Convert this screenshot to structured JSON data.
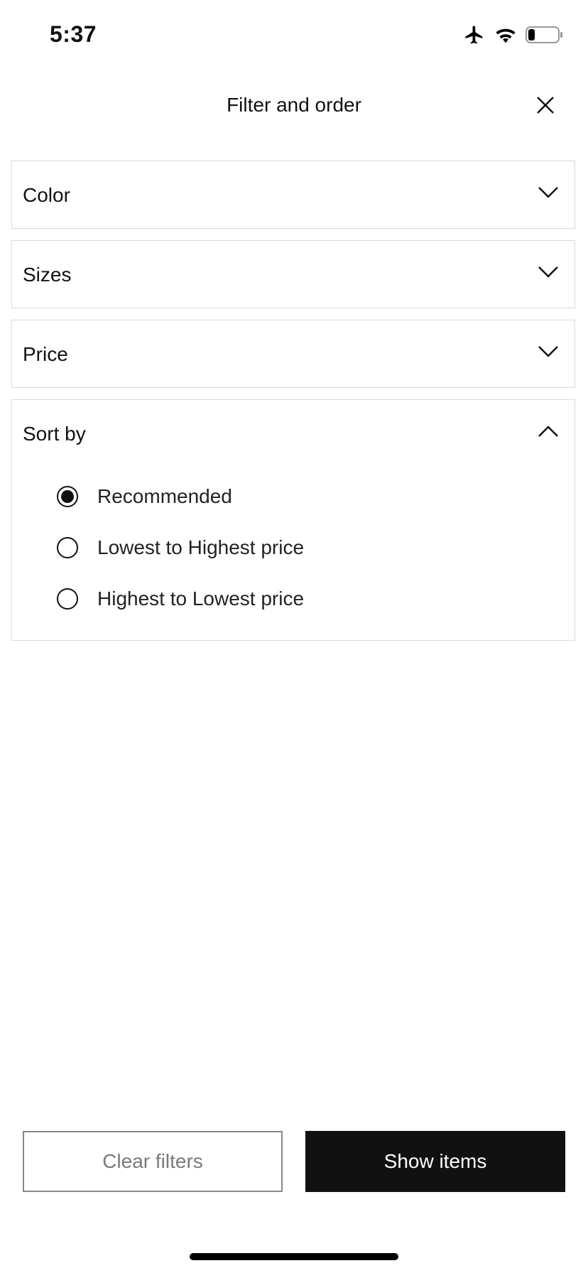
{
  "status_bar": {
    "time": "5:37",
    "icons": [
      "airplane-icon",
      "wifi-icon",
      "battery-icon"
    ]
  },
  "header": {
    "title": "Filter and order",
    "close_icon": "close-icon"
  },
  "filters": {
    "color": {
      "label": "Color",
      "expanded": false
    },
    "sizes": {
      "label": "Sizes",
      "expanded": false
    },
    "price": {
      "label": "Price",
      "expanded": false
    },
    "sort": {
      "label": "Sort by",
      "expanded": true,
      "options": [
        {
          "label": "Recommended",
          "selected": true
        },
        {
          "label": "Lowest to Highest price",
          "selected": false
        },
        {
          "label": "Highest to Lowest price",
          "selected": false
        }
      ]
    }
  },
  "footer": {
    "clear_label": "Clear filters",
    "show_label": "Show items"
  },
  "colors": {
    "primary": "#111111",
    "border": "#d9d9d9",
    "muted": "#7a7a7a"
  }
}
